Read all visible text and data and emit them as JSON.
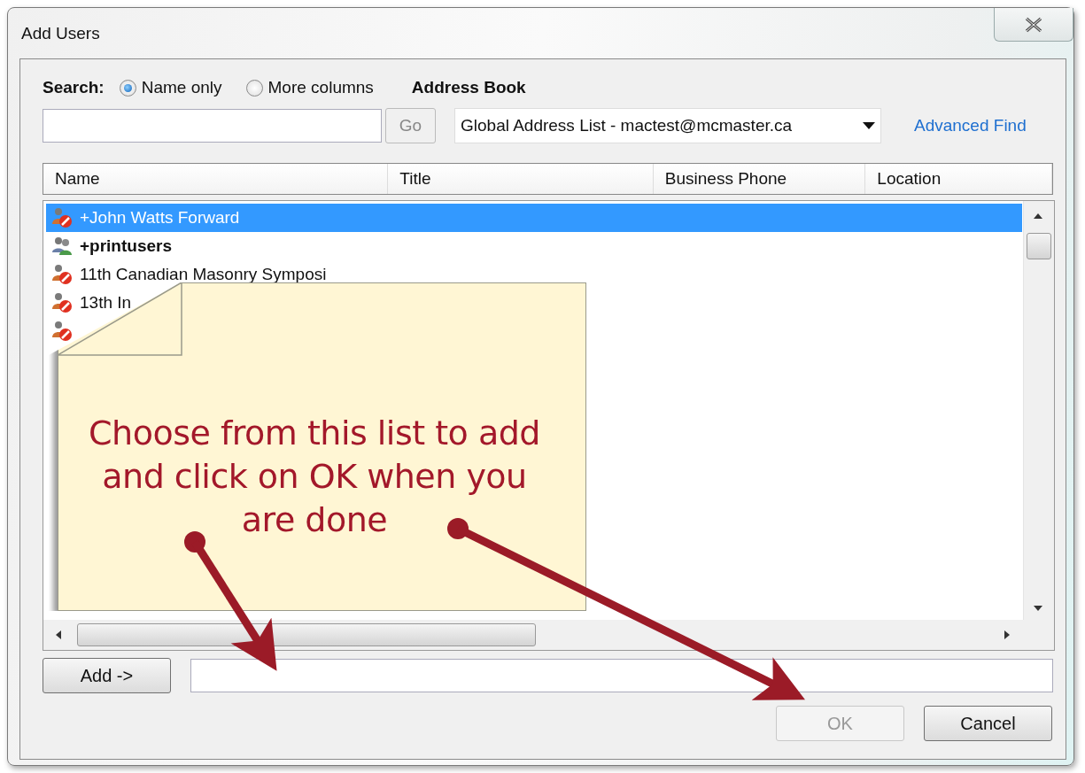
{
  "window": {
    "title": "Add Users"
  },
  "search": {
    "label": "Search:",
    "options": [
      {
        "label": "Name only",
        "selected": true
      },
      {
        "label": "More columns",
        "selected": false
      }
    ],
    "go": "Go"
  },
  "address_book": {
    "label": "Address Book",
    "value": "Global Address List - mactest@mcmaster.ca",
    "link": "Advanced Find"
  },
  "table": {
    "columns": [
      "Name",
      "Title",
      "Business Phone",
      "Location"
    ],
    "rows": [
      {
        "name": "+John Watts Forward",
        "kind": "person",
        "selected": true,
        "bold": false
      },
      {
        "name": "+printusers",
        "kind": "group",
        "selected": false,
        "bold": true
      },
      {
        "name": "11th Canadian Masonry Symposi",
        "kind": "person",
        "selected": false,
        "bold": false
      },
      {
        "name": "13th In",
        "kind": "person",
        "selected": false,
        "bold": false
      },
      {
        "kind": "person",
        "selected": false
      }
    ]
  },
  "note": {
    "text": "Choose from this list to add\nand click on OK when you\nare done"
  },
  "buttons": [
    {
      "label": "Add ->",
      "kind": "add",
      "disabled": false
    },
    {
      "label": "OK",
      "kind": "ok",
      "disabled": true
    },
    {
      "label": "Cancel",
      "kind": "cancel",
      "disabled": false
    }
  ]
}
